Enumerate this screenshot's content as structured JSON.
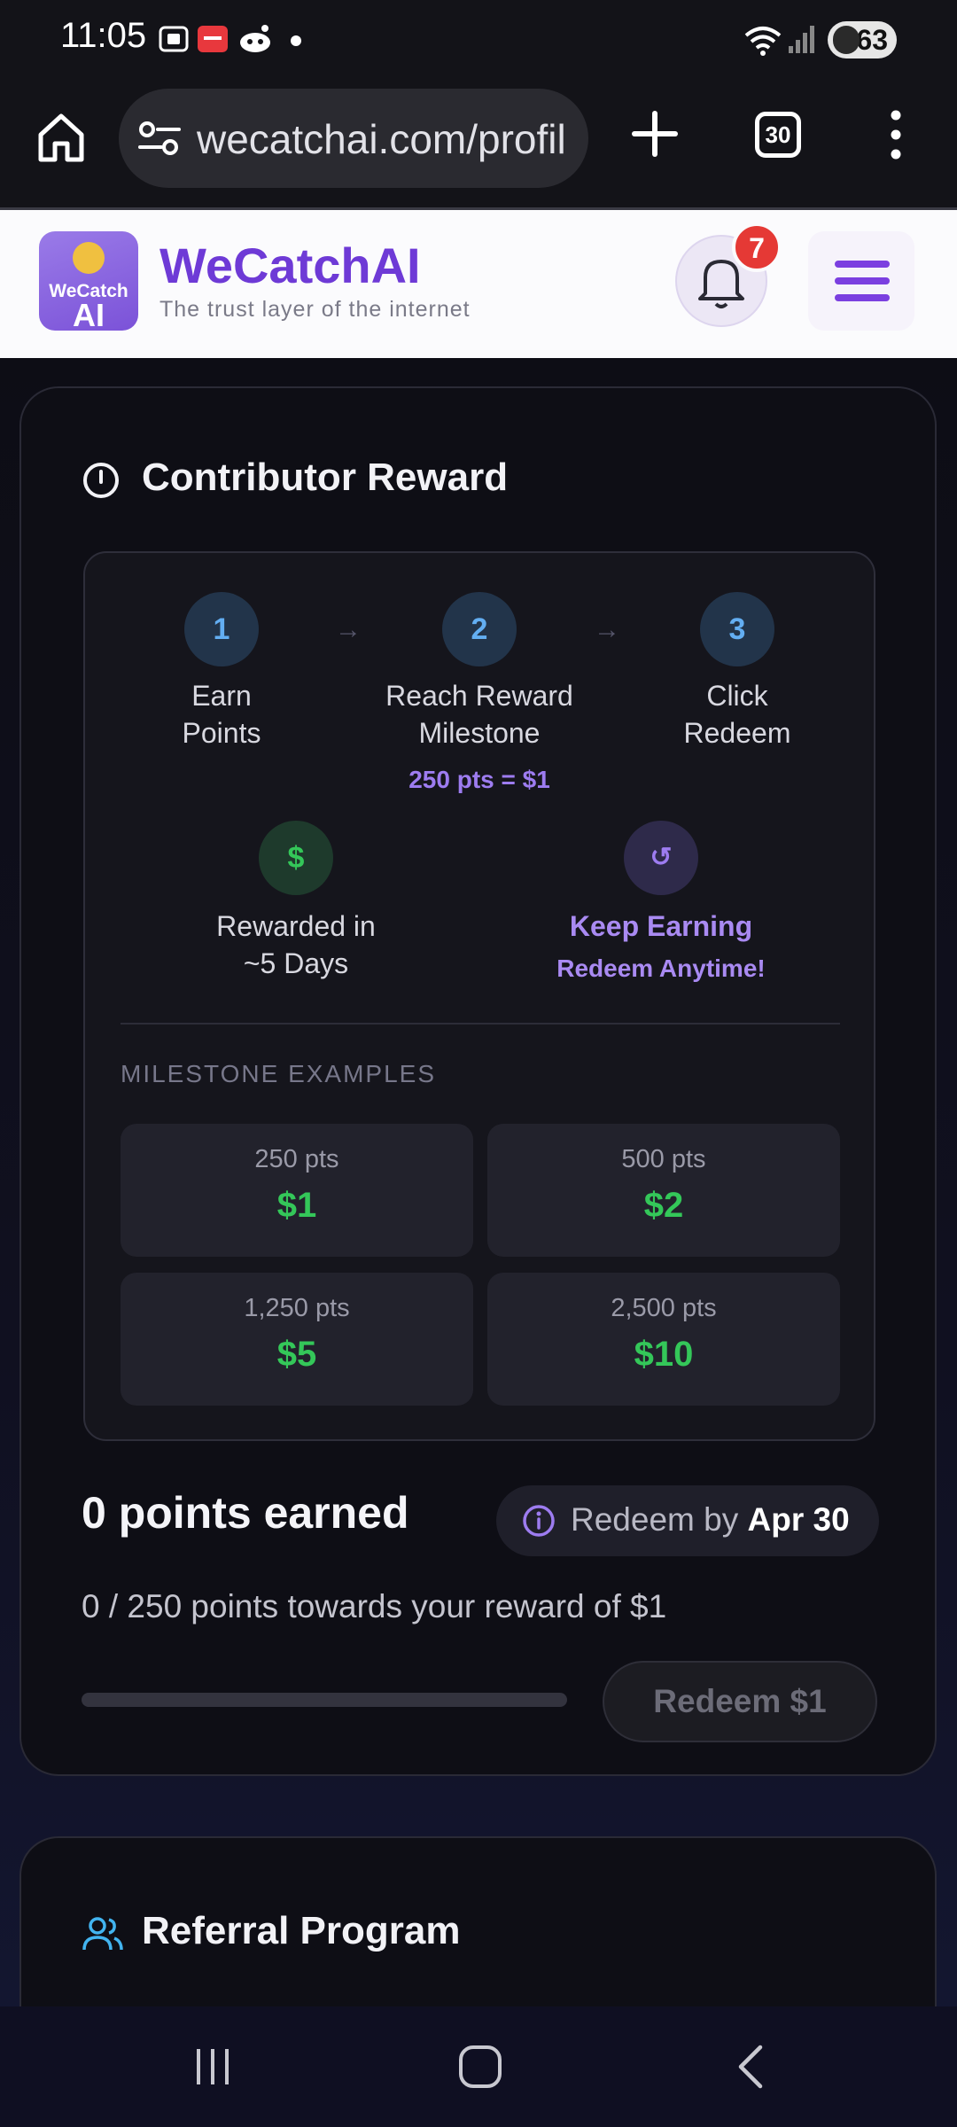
{
  "status_bar": {
    "time": "11:05",
    "battery": "63"
  },
  "browser": {
    "url": "wecatchai.com/profil",
    "tab_count": "30"
  },
  "site": {
    "name": "WeCatchAI",
    "tagline": "The trust layer of the internet",
    "logo_line1": "WeCatch",
    "logo_line2": "AI",
    "notification_count": "7"
  },
  "reward": {
    "title": "Contributor Reward",
    "steps": [
      {
        "number": "1",
        "label_line1": "Earn",
        "label_line2": "Points"
      },
      {
        "number": "2",
        "label_line1": "Reach Reward",
        "label_line2": "Milestone",
        "sub": "250 pts = $1"
      },
      {
        "number": "3",
        "label_line1": "Click",
        "label_line2": "Redeem"
      }
    ],
    "arrow": "→",
    "info": [
      {
        "symbol": "$",
        "line1": "Rewarded in",
        "line2": "~5 Days"
      },
      {
        "symbol": "↺",
        "line1": "Keep Earning",
        "line2": "Redeem Anytime!"
      }
    ],
    "milestones_label": "MILESTONE EXAMPLES",
    "milestones": [
      {
        "pts": "250 pts",
        "value": "$1"
      },
      {
        "pts": "500 pts",
        "value": "$2"
      },
      {
        "pts": "1,250 pts",
        "value": "$5"
      },
      {
        "pts": "2,500 pts",
        "value": "$10"
      }
    ],
    "points_earned": "0 points earned",
    "redeem_by_prefix": "Redeem by",
    "redeem_by_date": "Apr 30",
    "progress_text": "0 / 250 points towards your reward of $1",
    "progress_fraction": 0,
    "redeem_button": "Redeem $1"
  },
  "referral": {
    "title": "Referral Program"
  },
  "colors": {
    "brand_purple": "#6e3ad6",
    "accent_green": "#34c759",
    "step_blue": "#63aef2",
    "accent_lavender": "#9d7cf0",
    "badge_red": "#e53935"
  },
  "icons": [
    "home-icon",
    "site-settings-icon",
    "plus-icon",
    "tabs-icon",
    "more-vert-icon",
    "bell-icon",
    "menu-icon",
    "clock-icon",
    "info-icon",
    "people-icon",
    "recents-icon",
    "home-nav-icon",
    "back-icon"
  ]
}
